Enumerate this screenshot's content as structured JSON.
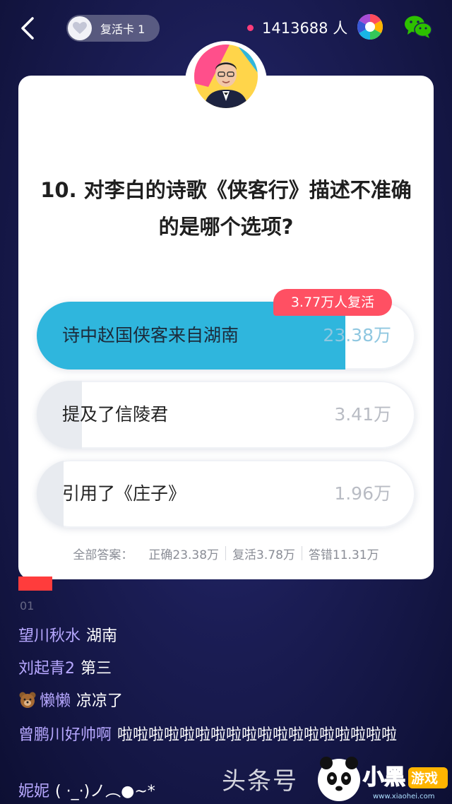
{
  "topbar": {
    "revive_card_label": "复活卡 1",
    "viewer_count": "1413688 人"
  },
  "question": {
    "text": "10. 对李白的诗歌《侠客行》描述不准确的是哪个选项?",
    "revive_tag": "3.77万人复活",
    "options": [
      {
        "label": "诗中赵国侠客来自湖南",
        "count": "23.38万",
        "fill_fraction": 0.815,
        "fill_color": "#2fb6dd",
        "correct": true
      },
      {
        "label": "提及了信陵君",
        "count": "3.41万",
        "fill_fraction": 0.12,
        "fill_color": "#e8ebf0",
        "correct": false
      },
      {
        "label": "引用了《庄子》",
        "count": "1.96万",
        "fill_fraction": 0.07,
        "fill_color": "#e8ebf0",
        "correct": false
      }
    ],
    "summary": {
      "label": "全部答案：",
      "correct": "正确23.38万",
      "revived": "复活3.78万",
      "wrong": "答错11.31万"
    }
  },
  "comments": {
    "partial_01": "01",
    "items": [
      {
        "name": "望川秋水",
        "text": "湖南"
      },
      {
        "name": "刘起青2",
        "text": "第三"
      },
      {
        "name": "懒懒",
        "text": "凉凉了",
        "icon": "bear-icon"
      },
      {
        "name": "曾鹏川好帅啊",
        "text": "啦啦啦啦啦啦啦啦啦啦啦啦啦啦啦啦啦啦"
      },
      {
        "name": "妮妮",
        "text": "( ·_·)ノ︵●~*"
      }
    ]
  },
  "watermark": {
    "text": "头条号"
  },
  "colors": {
    "accent": "#2fb6dd",
    "revive_tag": "#ff5063",
    "live_dot": "#ff3c7a",
    "comment_name": "#b7a8ff"
  }
}
